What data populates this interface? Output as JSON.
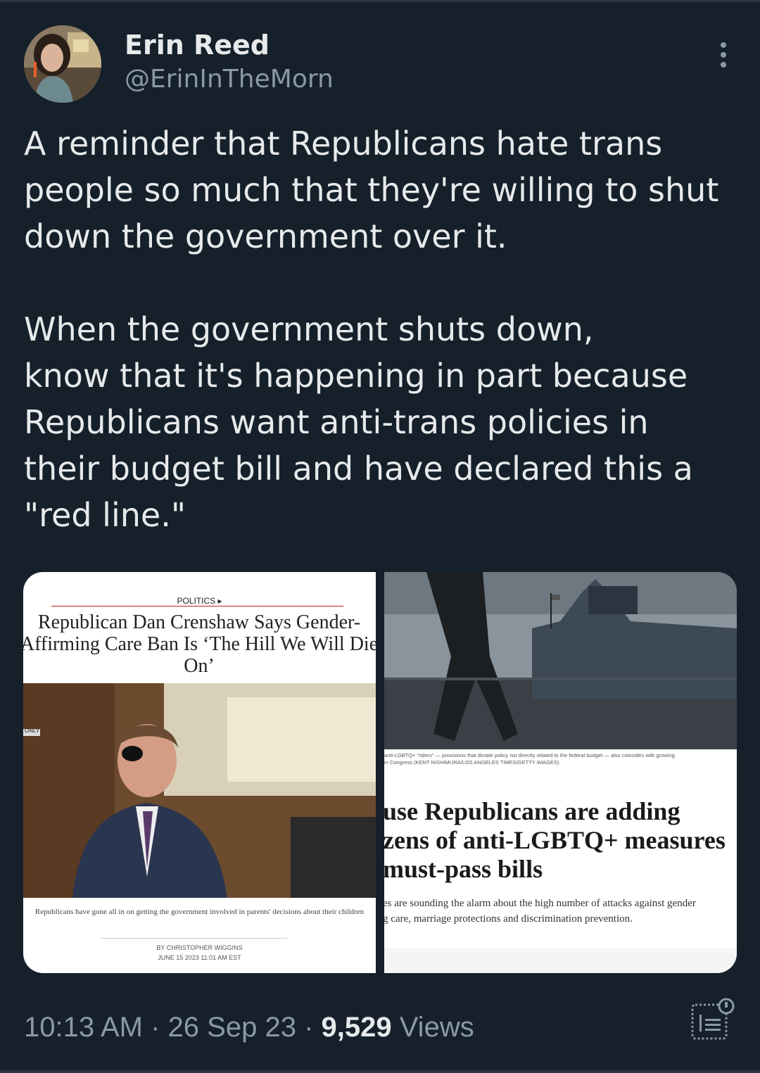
{
  "author": {
    "name": "Erin Reed",
    "handle": "@ErinInTheMorn"
  },
  "tweet": {
    "paragraph1": "A reminder that Republicans hate trans people so much that they're willing to shut down the government over it.",
    "paragraph2_lines": [
      "When the government shuts down,",
      "know that it's happening in part because",
      "Republicans want anti-trans policies in",
      "their budget bill and have declared this a",
      "\"red line.\""
    ],
    "paragraph1_lines": [
      "A reminder that Republicans hate trans",
      "people so much that they're willing to shut",
      "down the government over it."
    ]
  },
  "media": {
    "left": {
      "category": "POLITICS ▸",
      "headline_lines": [
        "Republican Dan Crenshaw Says Gender-",
        "Affirming Care Ban Is ‘The Hill We Will Die",
        "On’"
      ],
      "caption": "Republicans have gone all in on getting the government involved in parents' decisions about their children",
      "byline_author": "BY CHRISTOPHER WIGGINS",
      "byline_date": "JUNE 15 2023 11:01 AM EST",
      "nameplate_text": "ONLY"
    },
    "right": {
      "photo_caption_line1": "anti-LGBTQ+ \"riders\" — provisions that dictate policy not directly related to the federal budget — also coincides with growing",
      "photo_caption_line2": "in Congress (KENT NISHIMURA/LOS ANGELES TIMES/GETTY IMAGES)",
      "headline_lines": [
        "use Republicans are adding",
        "zens of anti-LGBTQ+ measures",
        "must-pass bills"
      ],
      "dek_lines": [
        "es are sounding the alarm about the high number of attacks against gender",
        "g care, marriage protections and discrimination prevention."
      ]
    }
  },
  "footer": {
    "time": "10:13 AM",
    "sep1": " · ",
    "date": "26 Sep 23",
    "sep2": " · ",
    "views_count": "9,529",
    "views_label": " Views"
  },
  "colors": {
    "background": "#15202b",
    "text_primary": "#e7e9ea",
    "text_secondary": "#8b98a5"
  },
  "icons": {
    "more": "more-options-icon",
    "analytics": "analytics-icon"
  }
}
